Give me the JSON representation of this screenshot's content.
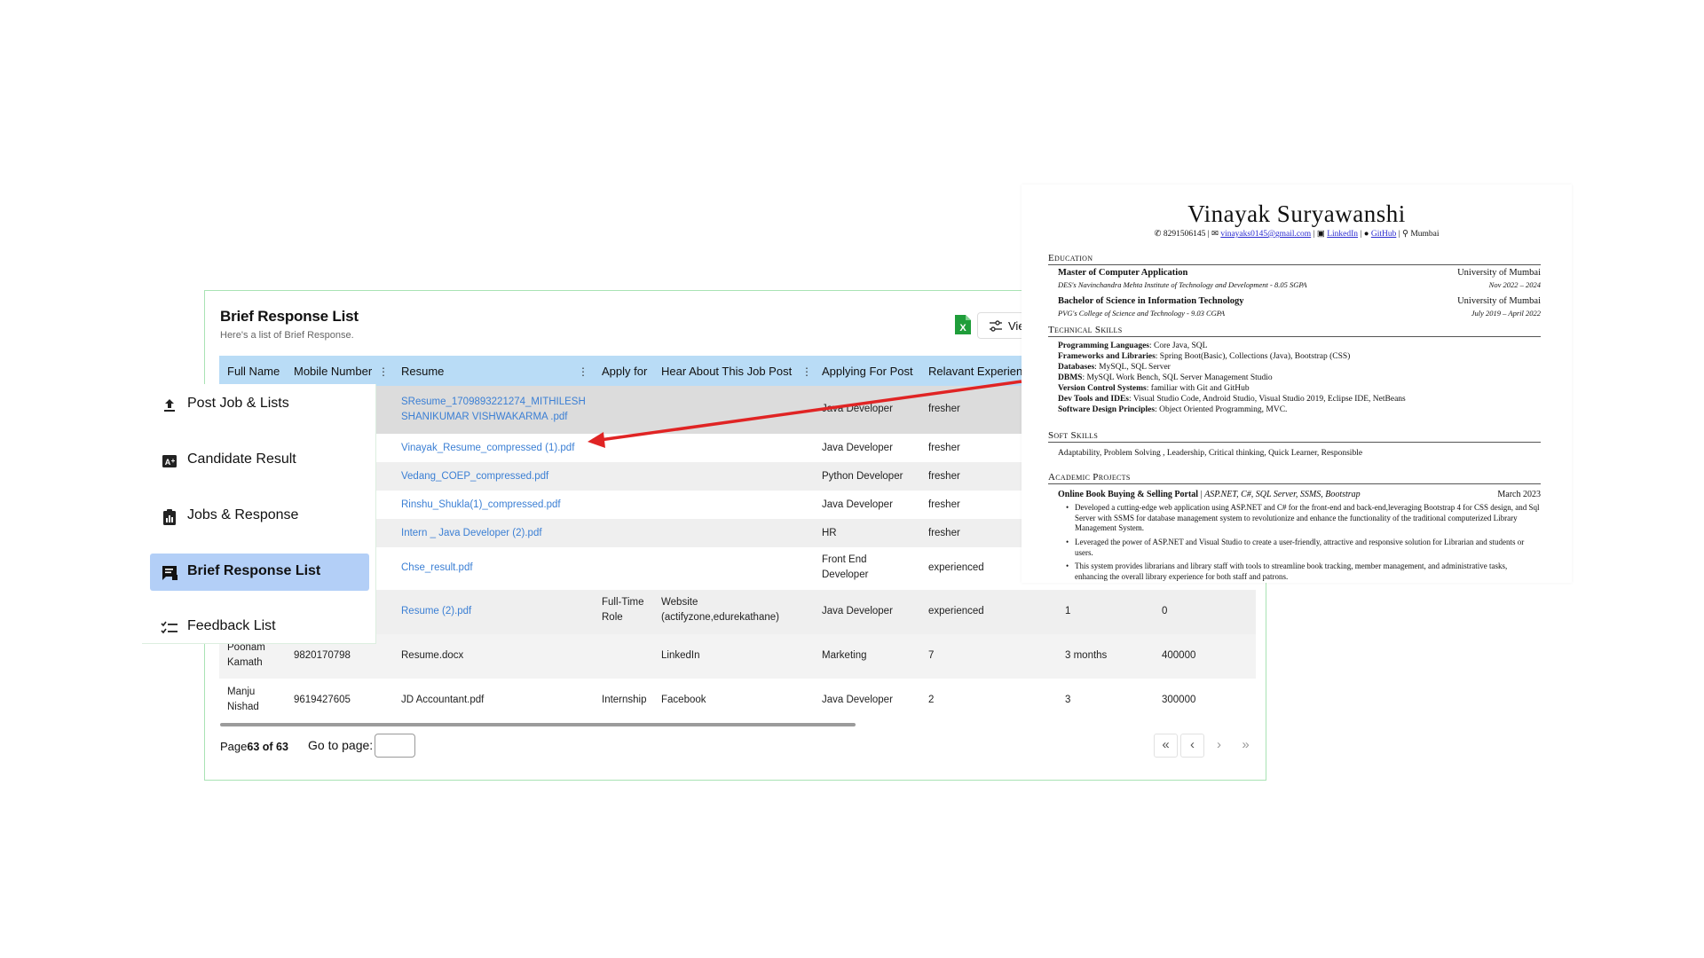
{
  "card": {
    "title": "Brief Response List",
    "subtitle": "Here's a list of Brief Response.",
    "view_label": "Vie",
    "excel_color": "#1f9d3a"
  },
  "table": {
    "headers": [
      "Full Name",
      "Mobile Number",
      "Resume",
      "Apply for",
      "Hear About This Job Post",
      "Applying For Post",
      "Relavant Experien"
    ],
    "rows": [
      {
        "resume": "SResume_1709893221274_MITHILESH SHANIKUMAR VISHWAKARMA .pdf",
        "post": "Java Developer",
        "exp": "fresher"
      },
      {
        "resume": "Vinayak_Resume_compressed (1).pdf",
        "post": "Java Developer",
        "exp": "fresher"
      },
      {
        "resume": "Vedang_COEP_compressed.pdf",
        "post": "Python Developer",
        "exp": "fresher"
      },
      {
        "resume": "Rinshu_Shukla(1)_compressed.pdf",
        "post": "Java Developer",
        "exp": "fresher"
      },
      {
        "resume": "Intern _ Java Developer (2).pdf",
        "post": "HR",
        "exp": "fresher"
      },
      {
        "resume": "Chse_result.pdf",
        "post": "Front End Developer",
        "exp": "experienced"
      },
      {
        "resume": "Resume (2).pdf",
        "apply": "Full-Time Role",
        "hear": "Website (actifyzone,edurekathane)",
        "post": "Java Developer",
        "exp": "experienced",
        "c8": "1",
        "c9": "0"
      },
      {
        "name": "Poonam Kamath",
        "mobile": "9820170798",
        "resume": "Resume.docx",
        "hear": "LinkedIn",
        "post": "Marketing",
        "exp": "7",
        "c8": "3 months",
        "c9": "400000"
      },
      {
        "name": "Manju Nishad",
        "mobile": "9619427605",
        "resume": "JD Accountant.pdf",
        "apply": "Internship",
        "hear": "Facebook",
        "post": "Java Developer",
        "exp": "2",
        "c8": "3",
        "c9": "300000"
      }
    ]
  },
  "footer": {
    "page_prefix": "Page",
    "page_value": "63 of 63",
    "goto_label": "Go to page:",
    "goto_value": "",
    "first": "«",
    "prev": "‹",
    "next": "›",
    "last": "»"
  },
  "sidebar": {
    "items": [
      {
        "label": "Post Job & Lists",
        "icon": "upload-icon"
      },
      {
        "label": "Candidate Result",
        "icon": "grade-icon"
      },
      {
        "label": "Jobs & Response",
        "icon": "clipboard-chart-icon"
      },
      {
        "label": "Brief Response List",
        "icon": "feedback-list-icon",
        "active": true
      },
      {
        "label": "Feedback List",
        "icon": "checklist-icon"
      }
    ],
    "active_color": "#b3cff7"
  },
  "resume": {
    "name": "Vinayak Suryawanshi",
    "phone": "8291506145",
    "email": "vinayaks0145@gmail.com",
    "linkedin": "LinkedIn",
    "github": "GitHub",
    "location": "Mumbai",
    "sections": {
      "education": "Education",
      "technical": "Technical Skills",
      "soft": "Soft Skills",
      "projects": "Academic Projects"
    },
    "education": [
      {
        "degree": "Master of Computer Application",
        "school": "University of Mumbai",
        "college": "DES's Navinchandra Mehta Institute of Technology and Development - 8.05 SGPA",
        "dates": "Nov 2022 – 2024"
      },
      {
        "degree": "Bachelor of Science in Information Technology",
        "school": "University of Mumbai",
        "college": "PVG's College of Science and Technology - 9.03 CGPA",
        "dates": "July 2019 – April 2022"
      }
    ],
    "skills": [
      {
        "k": "Programming Languages",
        "v": ": Core Java, SQL"
      },
      {
        "k": "Frameworks and Libraries",
        "v": ": Spring Boot(Basic), Collections (Java), Bootstrap (CSS)"
      },
      {
        "k": "Databases",
        "v": ": MySQL, SQL Server"
      },
      {
        "k": "DBMS",
        "v": ": MySQL Work Bench, SQL Server Management Studio"
      },
      {
        "k": "Version Control Systems",
        "v": ": familiar with Git and GitHub"
      },
      {
        "k": "Dev Tools and IDEs",
        "v": ": Visual Studio Code, Android Studio, Visual Studio 2019, Eclipse IDE, NetBeans"
      },
      {
        "k": "Software Design Principles",
        "v": ": Object Oriented Programming, MVC."
      }
    ],
    "soft_skills": "Adaptability, Problem Solving , Leadership, Critical thinking, Quick Learner, Responsible",
    "project_title": "Online Book Buying & Selling Portal",
    "project_tech": "ASP.NET, C#, SQL Server, SSMS, Bootstrap",
    "project_date": "March 2023",
    "bullets": [
      "Developed a cutting-edge web application using ASP.NET and C# for the front-end and back-end,leveraging Bootstrap 4 for CSS design, and Sql Server with SSMS for database management system to revolutionize and enhance the functionality of the traditional computerized Library Management System.",
      "Leveraged the power of ASP.NET and Visual Studio to create a user-friendly, attractive and responsive solution for Librarian and students or users.",
      "This system provides librarians and library staff with tools to streamline book tracking, member management, and administrative tasks, enhancing the overall library experience for both staff and patrons."
    ]
  },
  "arrow_color": "#e02424"
}
